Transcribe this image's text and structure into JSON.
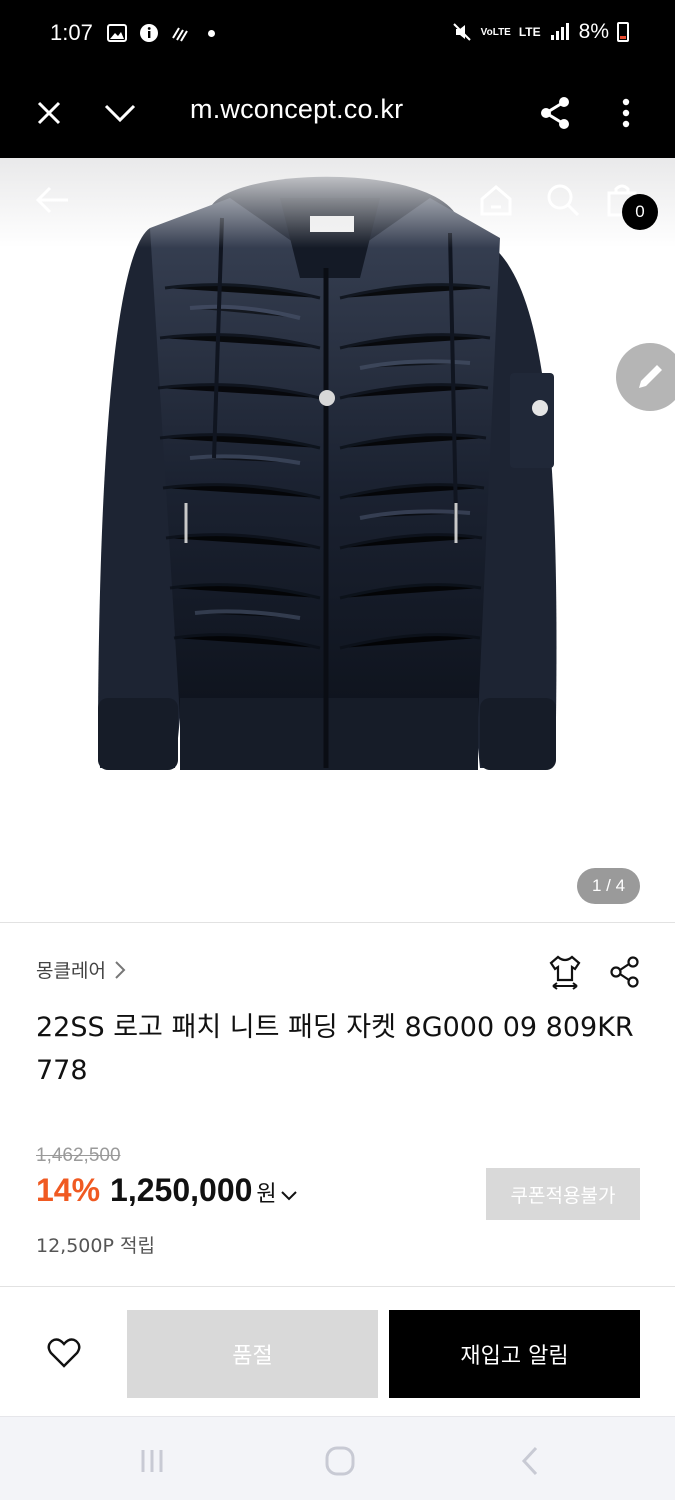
{
  "status_bar": {
    "time": "1:07",
    "network": "LTE",
    "volte": "VoLTE",
    "battery": "8%"
  },
  "browser": {
    "url": "m.wconcept.co.kr"
  },
  "product_image": {
    "counter": "1 / 4",
    "cart_count": "0",
    "colors": {
      "jacket": "#1d2433",
      "jacket_shadow": "#0f141e"
    }
  },
  "product": {
    "brand": "몽클레어",
    "title": "22SS 로고 패치 니트 패딩 자켓 8G000 09 809KR 778",
    "original_price": "1,462,500",
    "discount": "14%",
    "price": "1,250,000",
    "currency": "원",
    "coupon_label": "쿠폰적용불가",
    "points": "12,500P 적립"
  },
  "actions": {
    "soldout_label": "품절",
    "restock_label": "재입고 알림"
  },
  "colors": {
    "accent": "#f05a22",
    "disabled": "#d9d9d9",
    "primary": "#000000"
  }
}
